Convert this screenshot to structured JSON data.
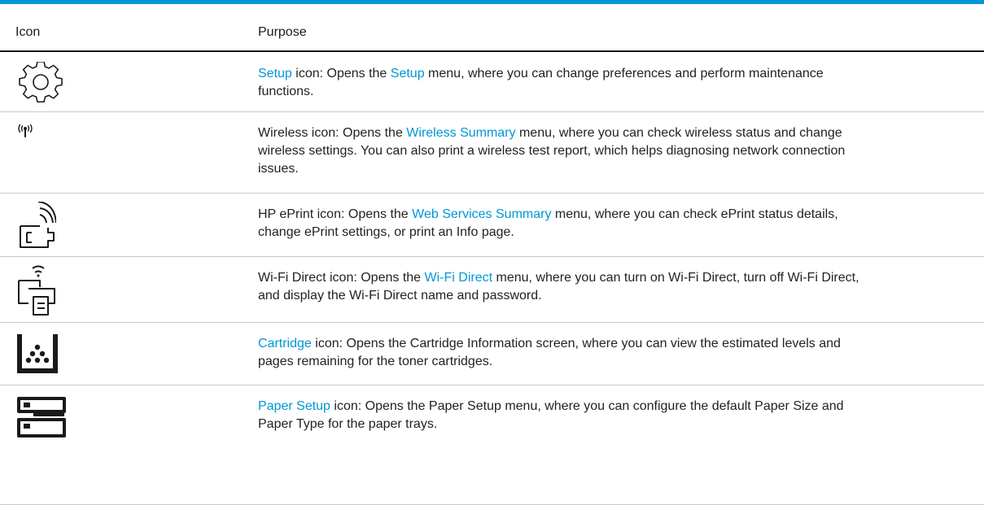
{
  "table": {
    "header_icon": "Icon",
    "header_purpose": "Purpose"
  },
  "rows": [
    {
      "icon": "gear-icon",
      "link1": "Setup",
      "t1": " icon: Opens the ",
      "link2": "Setup",
      "t2": " menu, where you can change preferences and perform maintenance functions."
    },
    {
      "icon": "wireless-icon",
      "t0": "Wireless icon: Opens the ",
      "link1": "Wireless Summary",
      "t1": " menu, where you can check wireless status and change wireless settings. You can also print a wireless test report, which helps diagnosing network connection issues."
    },
    {
      "icon": "eprint-icon",
      "t0": "HP ePrint icon: Opens the ",
      "link1": "Web Services Summary",
      "t1": " menu, where you can check ePrint status details, change ePrint settings, or print an Info page."
    },
    {
      "icon": "wifi-direct-icon",
      "t0": "Wi-Fi Direct icon: Opens the ",
      "link1": "Wi-Fi Direct",
      "t1": " menu, where you can turn on Wi-Fi Direct, turn off Wi-Fi Direct, and display the Wi-Fi Direct name and password."
    },
    {
      "icon": "cartridge-icon",
      "link1": "Cartridge",
      "t1": " icon: Opens the Cartridge Information screen, where you can view the estimated levels and pages remaining for the toner cartridges."
    },
    {
      "icon": "paper-setup-icon",
      "link1": "Paper Setup",
      "t1": " icon: Opens the Paper Setup menu, where you can configure the default Paper Size and Paper Type for the paper trays."
    }
  ],
  "colors": {
    "accent": "#0096d6",
    "text": "#1a1a1a",
    "divider": "#c9c9c9"
  }
}
